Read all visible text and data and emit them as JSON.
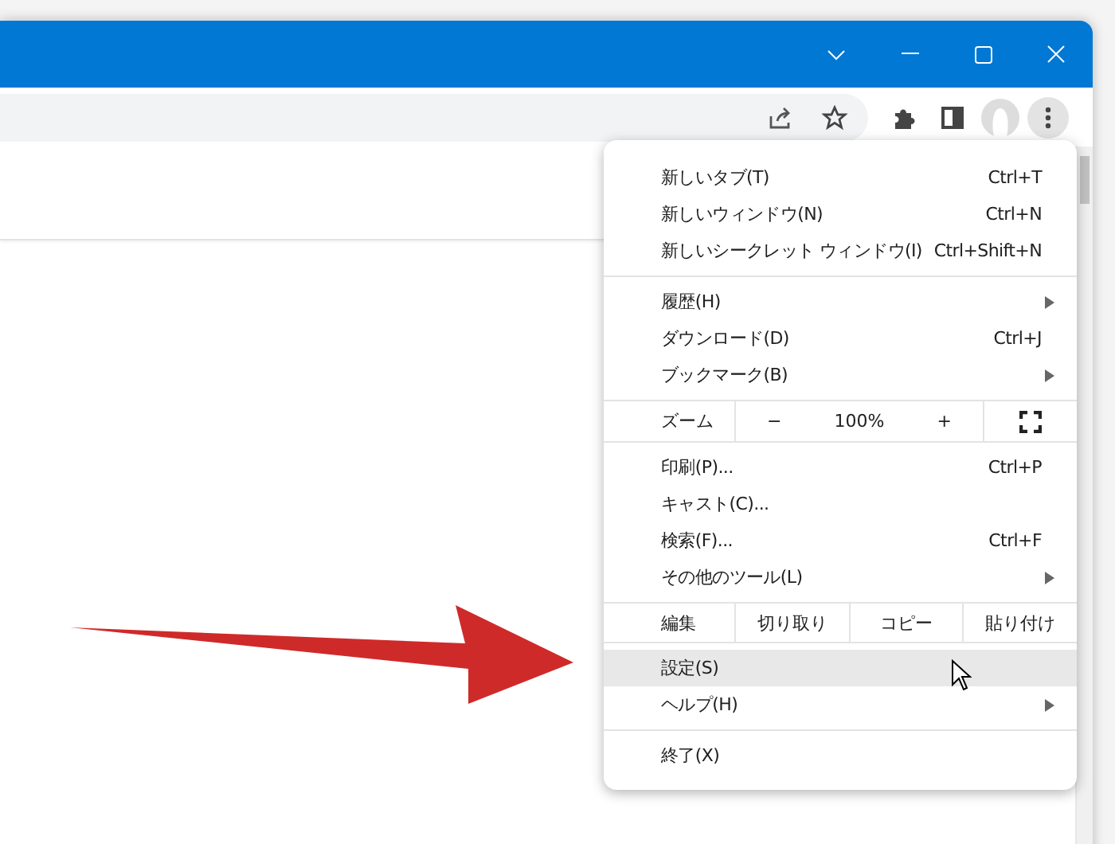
{
  "menu": {
    "sections": [
      {
        "kind": "items",
        "items": [
          {
            "label": "新しいタブ(T)",
            "shortcut": "Ctrl+T",
            "submenu": false,
            "highlighted": false
          },
          {
            "label": "新しいウィンドウ(N)",
            "shortcut": "Ctrl+N",
            "submenu": false,
            "highlighted": false
          },
          {
            "label": "新しいシークレット ウィンドウ(I)",
            "shortcut": "Ctrl+Shift+N",
            "submenu": false,
            "highlighted": false
          }
        ]
      },
      {
        "kind": "items",
        "items": [
          {
            "label": "履歴(H)",
            "submenu": true,
            "highlighted": false
          },
          {
            "label": "ダウンロード(D)",
            "shortcut": "Ctrl+J",
            "submenu": false,
            "highlighted": false
          },
          {
            "label": "ブックマーク(B)",
            "submenu": true,
            "highlighted": false
          }
        ]
      },
      {
        "kind": "zoom",
        "label": "ズーム",
        "minus": "−",
        "value": "100%",
        "plus": "+"
      },
      {
        "kind": "items",
        "items": [
          {
            "label": "印刷(P)...",
            "shortcut": "Ctrl+P",
            "submenu": false,
            "highlighted": false
          },
          {
            "label": "キャスト(C)...",
            "submenu": false,
            "highlighted": false
          },
          {
            "label": "検索(F)...",
            "shortcut": "Ctrl+F",
            "submenu": false,
            "highlighted": false
          },
          {
            "label": "その他のツール(L)",
            "submenu": true,
            "highlighted": false
          }
        ]
      },
      {
        "kind": "edit",
        "label": "編集",
        "buttons": [
          "切り取り",
          "コピー",
          "貼り付け"
        ]
      },
      {
        "kind": "items",
        "items": [
          {
            "label": "設定(S)",
            "submenu": false,
            "highlighted": true
          },
          {
            "label": "ヘルプ(H)",
            "submenu": true,
            "highlighted": false
          }
        ]
      },
      {
        "kind": "items",
        "items": [
          {
            "label": "終了(X)",
            "submenu": false,
            "highlighted": false
          }
        ]
      }
    ]
  }
}
